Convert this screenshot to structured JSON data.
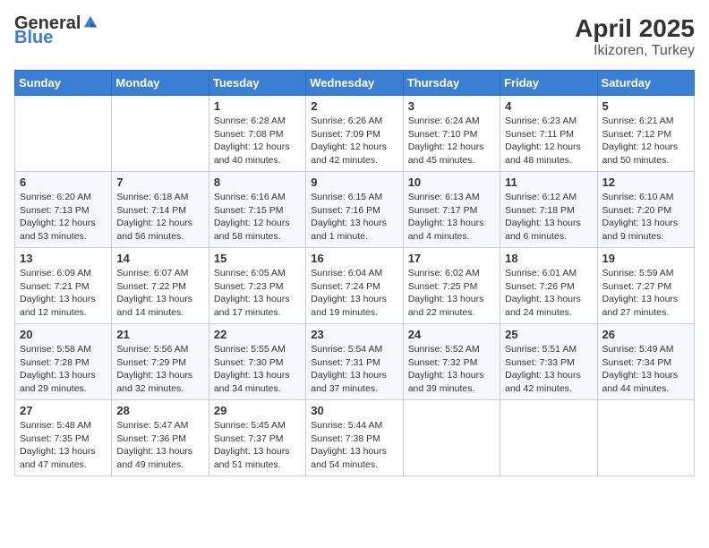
{
  "header": {
    "logo_general": "General",
    "logo_blue": "Blue",
    "title": "April 2025",
    "subtitle": "Ikizoren, Turkey"
  },
  "days_of_week": [
    "Sunday",
    "Monday",
    "Tuesday",
    "Wednesday",
    "Thursday",
    "Friday",
    "Saturday"
  ],
  "weeks": [
    [
      {
        "day": "",
        "info": ""
      },
      {
        "day": "",
        "info": ""
      },
      {
        "day": "1",
        "info": "Sunrise: 6:28 AM\nSunset: 7:08 PM\nDaylight: 12 hours and 40 minutes."
      },
      {
        "day": "2",
        "info": "Sunrise: 6:26 AM\nSunset: 7:09 PM\nDaylight: 12 hours and 42 minutes."
      },
      {
        "day": "3",
        "info": "Sunrise: 6:24 AM\nSunset: 7:10 PM\nDaylight: 12 hours and 45 minutes."
      },
      {
        "day": "4",
        "info": "Sunrise: 6:23 AM\nSunset: 7:11 PM\nDaylight: 12 hours and 48 minutes."
      },
      {
        "day": "5",
        "info": "Sunrise: 6:21 AM\nSunset: 7:12 PM\nDaylight: 12 hours and 50 minutes."
      }
    ],
    [
      {
        "day": "6",
        "info": "Sunrise: 6:20 AM\nSunset: 7:13 PM\nDaylight: 12 hours and 53 minutes."
      },
      {
        "day": "7",
        "info": "Sunrise: 6:18 AM\nSunset: 7:14 PM\nDaylight: 12 hours and 56 minutes."
      },
      {
        "day": "8",
        "info": "Sunrise: 6:16 AM\nSunset: 7:15 PM\nDaylight: 12 hours and 58 minutes."
      },
      {
        "day": "9",
        "info": "Sunrise: 6:15 AM\nSunset: 7:16 PM\nDaylight: 13 hours and 1 minute."
      },
      {
        "day": "10",
        "info": "Sunrise: 6:13 AM\nSunset: 7:17 PM\nDaylight: 13 hours and 4 minutes."
      },
      {
        "day": "11",
        "info": "Sunrise: 6:12 AM\nSunset: 7:18 PM\nDaylight: 13 hours and 6 minutes."
      },
      {
        "day": "12",
        "info": "Sunrise: 6:10 AM\nSunset: 7:20 PM\nDaylight: 13 hours and 9 minutes."
      }
    ],
    [
      {
        "day": "13",
        "info": "Sunrise: 6:09 AM\nSunset: 7:21 PM\nDaylight: 13 hours and 12 minutes."
      },
      {
        "day": "14",
        "info": "Sunrise: 6:07 AM\nSunset: 7:22 PM\nDaylight: 13 hours and 14 minutes."
      },
      {
        "day": "15",
        "info": "Sunrise: 6:05 AM\nSunset: 7:23 PM\nDaylight: 13 hours and 17 minutes."
      },
      {
        "day": "16",
        "info": "Sunrise: 6:04 AM\nSunset: 7:24 PM\nDaylight: 13 hours and 19 minutes."
      },
      {
        "day": "17",
        "info": "Sunrise: 6:02 AM\nSunset: 7:25 PM\nDaylight: 13 hours and 22 minutes."
      },
      {
        "day": "18",
        "info": "Sunrise: 6:01 AM\nSunset: 7:26 PM\nDaylight: 13 hours and 24 minutes."
      },
      {
        "day": "19",
        "info": "Sunrise: 5:59 AM\nSunset: 7:27 PM\nDaylight: 13 hours and 27 minutes."
      }
    ],
    [
      {
        "day": "20",
        "info": "Sunrise: 5:58 AM\nSunset: 7:28 PM\nDaylight: 13 hours and 29 minutes."
      },
      {
        "day": "21",
        "info": "Sunrise: 5:56 AM\nSunset: 7:29 PM\nDaylight: 13 hours and 32 minutes."
      },
      {
        "day": "22",
        "info": "Sunrise: 5:55 AM\nSunset: 7:30 PM\nDaylight: 13 hours and 34 minutes."
      },
      {
        "day": "23",
        "info": "Sunrise: 5:54 AM\nSunset: 7:31 PM\nDaylight: 13 hours and 37 minutes."
      },
      {
        "day": "24",
        "info": "Sunrise: 5:52 AM\nSunset: 7:32 PM\nDaylight: 13 hours and 39 minutes."
      },
      {
        "day": "25",
        "info": "Sunrise: 5:51 AM\nSunset: 7:33 PM\nDaylight: 13 hours and 42 minutes."
      },
      {
        "day": "26",
        "info": "Sunrise: 5:49 AM\nSunset: 7:34 PM\nDaylight: 13 hours and 44 minutes."
      }
    ],
    [
      {
        "day": "27",
        "info": "Sunrise: 5:48 AM\nSunset: 7:35 PM\nDaylight: 13 hours and 47 minutes."
      },
      {
        "day": "28",
        "info": "Sunrise: 5:47 AM\nSunset: 7:36 PM\nDaylight: 13 hours and 49 minutes."
      },
      {
        "day": "29",
        "info": "Sunrise: 5:45 AM\nSunset: 7:37 PM\nDaylight: 13 hours and 51 minutes."
      },
      {
        "day": "30",
        "info": "Sunrise: 5:44 AM\nSunset: 7:38 PM\nDaylight: 13 hours and 54 minutes."
      },
      {
        "day": "",
        "info": ""
      },
      {
        "day": "",
        "info": ""
      },
      {
        "day": "",
        "info": ""
      }
    ]
  ]
}
